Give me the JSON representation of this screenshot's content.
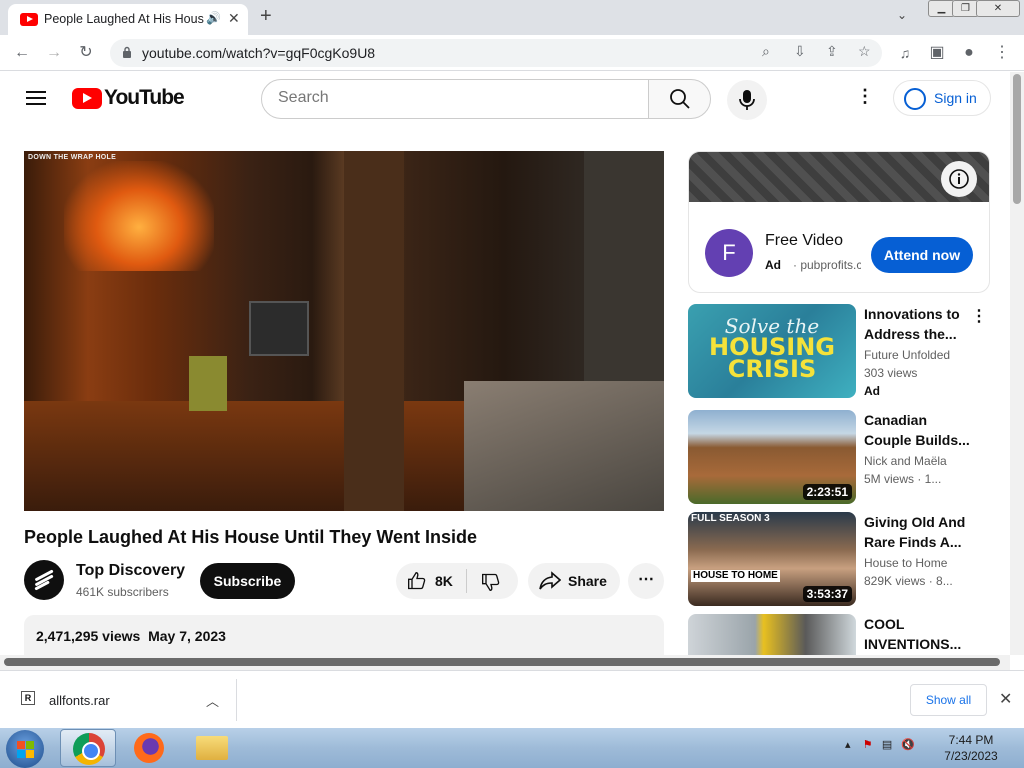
{
  "browser": {
    "tab_title": "People Laughed At His House Until They Went Inside",
    "new_tab": "+",
    "url": "youtube.com/watch?v=gqF0cgKo9U8"
  },
  "youtube": {
    "logo_text": "YouTube",
    "search_placeholder": "Search",
    "sign_in": "Sign in"
  },
  "video": {
    "overlay_caption": "DOWN THE WRAP HOLE",
    "title": "People Laughed At His House Until They Went Inside",
    "channel": "Top Discovery",
    "subscribers": "461K subscribers",
    "subscribe_label": "Subscribe",
    "likes": "8K",
    "share_label": "Share",
    "views": "2,471,295 views",
    "date": "May 7, 2023"
  },
  "ad": {
    "avatar_letter": "F",
    "title": "Free Video",
    "label": "Ad",
    "domain": "· pubprofits.com",
    "cta": "Attend now"
  },
  "related": [
    {
      "title": "Innovations to Address the...",
      "channel": "Future Unfolded",
      "views": "303 views",
      "ad": "Ad",
      "thumb_text_a": "Solve the",
      "thumb_text_b": "HOUSING CRISIS"
    },
    {
      "title": "Canadian Couple Builds...",
      "channel": "Nick and Maëla",
      "views": "5M views · 1...",
      "duration": "2:23:51"
    },
    {
      "title": "Giving Old And Rare Finds A...",
      "channel": "House to Home",
      "views": "829K views · 8...",
      "duration": "3:53:37",
      "thumb_caption": "FULL SEASON 3",
      "thumb_logo": "HOUSE TO HOME"
    },
    {
      "title": "COOL INVENTIONS..."
    }
  ],
  "downloads": {
    "file": "allfonts.rar",
    "show_all": "Show all"
  },
  "taskbar": {
    "time": "7:44 PM",
    "date": "7/23/2023"
  }
}
